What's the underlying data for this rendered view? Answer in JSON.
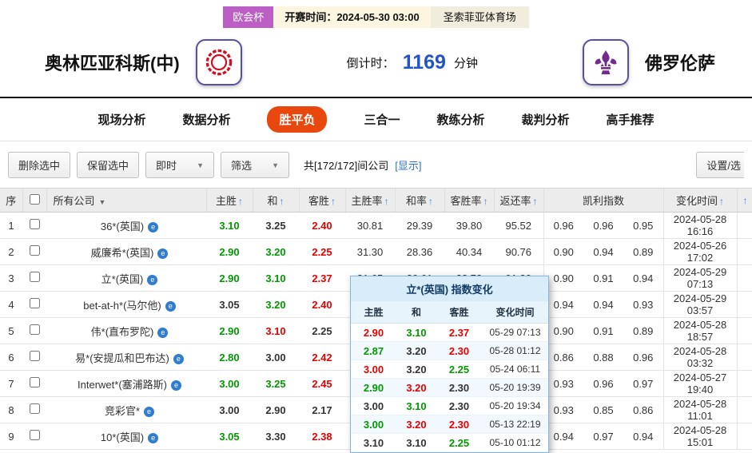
{
  "header": {
    "league": "欧会杯",
    "kickoff_label": "开赛时间：",
    "kickoff_time": "2024-05-30 03:00",
    "venue": "圣索菲亚体育场",
    "home_team": "奥林匹亚科斯(中)",
    "away_team": "佛罗伦萨",
    "countdown_label": "倒计时：",
    "countdown_value": "1169",
    "countdown_unit": "分钟",
    "accent_blue": "#2353c8",
    "badge_color": "#bc5fc4"
  },
  "nav": {
    "active_color": "#e8470e",
    "tabs": [
      {
        "label": "现场分析",
        "active": false
      },
      {
        "label": "数据分析",
        "active": false
      },
      {
        "label": "胜平负",
        "active": true
      },
      {
        "label": "三合一",
        "active": false
      },
      {
        "label": "教练分析",
        "active": false
      },
      {
        "label": "裁判分析",
        "active": false
      },
      {
        "label": "高手推荐",
        "active": false
      }
    ]
  },
  "toolbar": {
    "delete_selected": "删除选中",
    "keep_selected": "保留选中",
    "instant": "即时",
    "filter": "筛选",
    "count_text": "共[172/172]间公司",
    "show_link": "[显示]",
    "settings": "设置/选"
  },
  "table": {
    "up_color": "#e60000",
    "down_color": "#009a00",
    "headers": {
      "no": "序",
      "company": "所有公司",
      "home": "主胜",
      "draw": "和",
      "away": "客胜",
      "home_rate": "主胜率",
      "draw_rate": "和率",
      "away_rate": "客胜率",
      "return_rate": "返还率",
      "kelly": "凯利指数",
      "change_time": "变化时间"
    },
    "rows": [
      {
        "no": "1",
        "name": "36*(英国)",
        "odds": [
          [
            "3.10",
            "g"
          ],
          [
            "3.25",
            "b"
          ],
          [
            "2.40",
            "r"
          ]
        ],
        "rates": [
          "30.81",
          "29.39",
          "39.80",
          "95.52"
        ],
        "kelly": [
          "0.96",
          "0.96",
          "0.95"
        ],
        "date": "2024-05-28",
        "time": "16:16"
      },
      {
        "no": "2",
        "name": "威廉希*(英国)",
        "odds": [
          [
            "2.90",
            "g"
          ],
          [
            "3.20",
            "g"
          ],
          [
            "2.25",
            "r"
          ]
        ],
        "rates": [
          "31.30",
          "28.36",
          "40.34",
          "90.76"
        ],
        "kelly": [
          "0.90",
          "0.94",
          "0.89"
        ],
        "date": "2024-05-26",
        "time": "17:02"
      },
      {
        "no": "3",
        "name": "立*(英国)",
        "odds": [
          [
            "2.90",
            "g"
          ],
          [
            "3.10",
            "g"
          ],
          [
            "2.37",
            "r"
          ]
        ],
        "rates": [
          "31.65",
          "29.61",
          "38.73",
          "91.80"
        ],
        "kelly": [
          "0.90",
          "0.91",
          "0.94"
        ],
        "date": "2024-05-29",
        "time": "07:13"
      },
      {
        "no": "4",
        "name": "bet-at-h*(马尔他)",
        "odds": [
          [
            "3.05",
            "b"
          ],
          [
            "3.20",
            "g"
          ],
          [
            "2.40",
            "r"
          ]
        ],
        "rates": [
          "",
          "",
          "",
          ""
        ],
        "kelly": [
          "0.94",
          "0.94",
          "0.93"
        ],
        "date": "2024-05-29",
        "time": "03:57"
      },
      {
        "no": "5",
        "name": "伟*(直布罗陀)",
        "odds": [
          [
            "2.90",
            "g"
          ],
          [
            "3.10",
            "r"
          ],
          [
            "2.25",
            "b"
          ]
        ],
        "rates": [
          "",
          "",
          "",
          ""
        ],
        "kelly": [
          "0.90",
          "0.91",
          "0.89"
        ],
        "date": "2024-05-28",
        "time": "18:57"
      },
      {
        "no": "6",
        "name": "易*(安提瓜和巴布达)",
        "odds": [
          [
            "2.80",
            "g"
          ],
          [
            "3.00",
            "b"
          ],
          [
            "2.42",
            "r"
          ]
        ],
        "rates": [
          "",
          "",
          "",
          ""
        ],
        "kelly": [
          "0.86",
          "0.88",
          "0.96"
        ],
        "date": "2024-05-28",
        "time": "03:32"
      },
      {
        "no": "7",
        "name": "Interwet*(塞浦路斯)",
        "odds": [
          [
            "3.00",
            "g"
          ],
          [
            "3.25",
            "g"
          ],
          [
            "2.45",
            "r"
          ]
        ],
        "rates": [
          "",
          "",
          "",
          ""
        ],
        "kelly": [
          "0.93",
          "0.96",
          "0.97"
        ],
        "date": "2024-05-27",
        "time": "19:40"
      },
      {
        "no": "8",
        "name": "竞彩官*",
        "odds": [
          [
            "3.00",
            "b"
          ],
          [
            "2.90",
            "b"
          ],
          [
            "2.17",
            "b"
          ]
        ],
        "rates": [
          "",
          "",
          "",
          ""
        ],
        "kelly": [
          "0.93",
          "0.85",
          "0.86"
        ],
        "date": "2024-05-28",
        "time": "11:01"
      },
      {
        "no": "9",
        "name": "10*(英国)",
        "odds": [
          [
            "3.05",
            "g"
          ],
          [
            "3.30",
            "b"
          ],
          [
            "2.38",
            "r"
          ]
        ],
        "rates": [
          "",
          "",
          "",
          ""
        ],
        "kelly": [
          "0.94",
          "0.97",
          "0.94"
        ],
        "date": "2024-05-28",
        "time": "15:01"
      }
    ]
  },
  "popup": {
    "title": "立*(英国) 指数变化",
    "headers": [
      "主胜",
      "和",
      "客胜",
      "变化时间"
    ],
    "rows": [
      {
        "vals": [
          [
            "2.90",
            "r"
          ],
          [
            "3.10",
            "g"
          ],
          [
            "2.37",
            "r"
          ]
        ],
        "time": "05-29 07:13"
      },
      {
        "vals": [
          [
            "2.87",
            "g"
          ],
          [
            "3.20",
            "b"
          ],
          [
            "2.30",
            "r"
          ]
        ],
        "time": "05-28 01:12"
      },
      {
        "vals": [
          [
            "3.00",
            "r"
          ],
          [
            "3.20",
            "b"
          ],
          [
            "2.25",
            "g"
          ]
        ],
        "time": "05-24 06:11"
      },
      {
        "vals": [
          [
            "2.90",
            "g"
          ],
          [
            "3.20",
            "r"
          ],
          [
            "2.30",
            "b"
          ]
        ],
        "time": "05-20 19:39"
      },
      {
        "vals": [
          [
            "3.00",
            "b"
          ],
          [
            "3.10",
            "g"
          ],
          [
            "2.30",
            "b"
          ]
        ],
        "time": "05-20 19:34"
      },
      {
        "vals": [
          [
            "3.00",
            "g"
          ],
          [
            "3.20",
            "r"
          ],
          [
            "2.30",
            "r"
          ]
        ],
        "time": "05-13 22:19"
      },
      {
        "vals": [
          [
            "3.10",
            "b"
          ],
          [
            "3.10",
            "b"
          ],
          [
            "2.25",
            "g"
          ]
        ],
        "time": "05-10 01:12"
      }
    ]
  }
}
